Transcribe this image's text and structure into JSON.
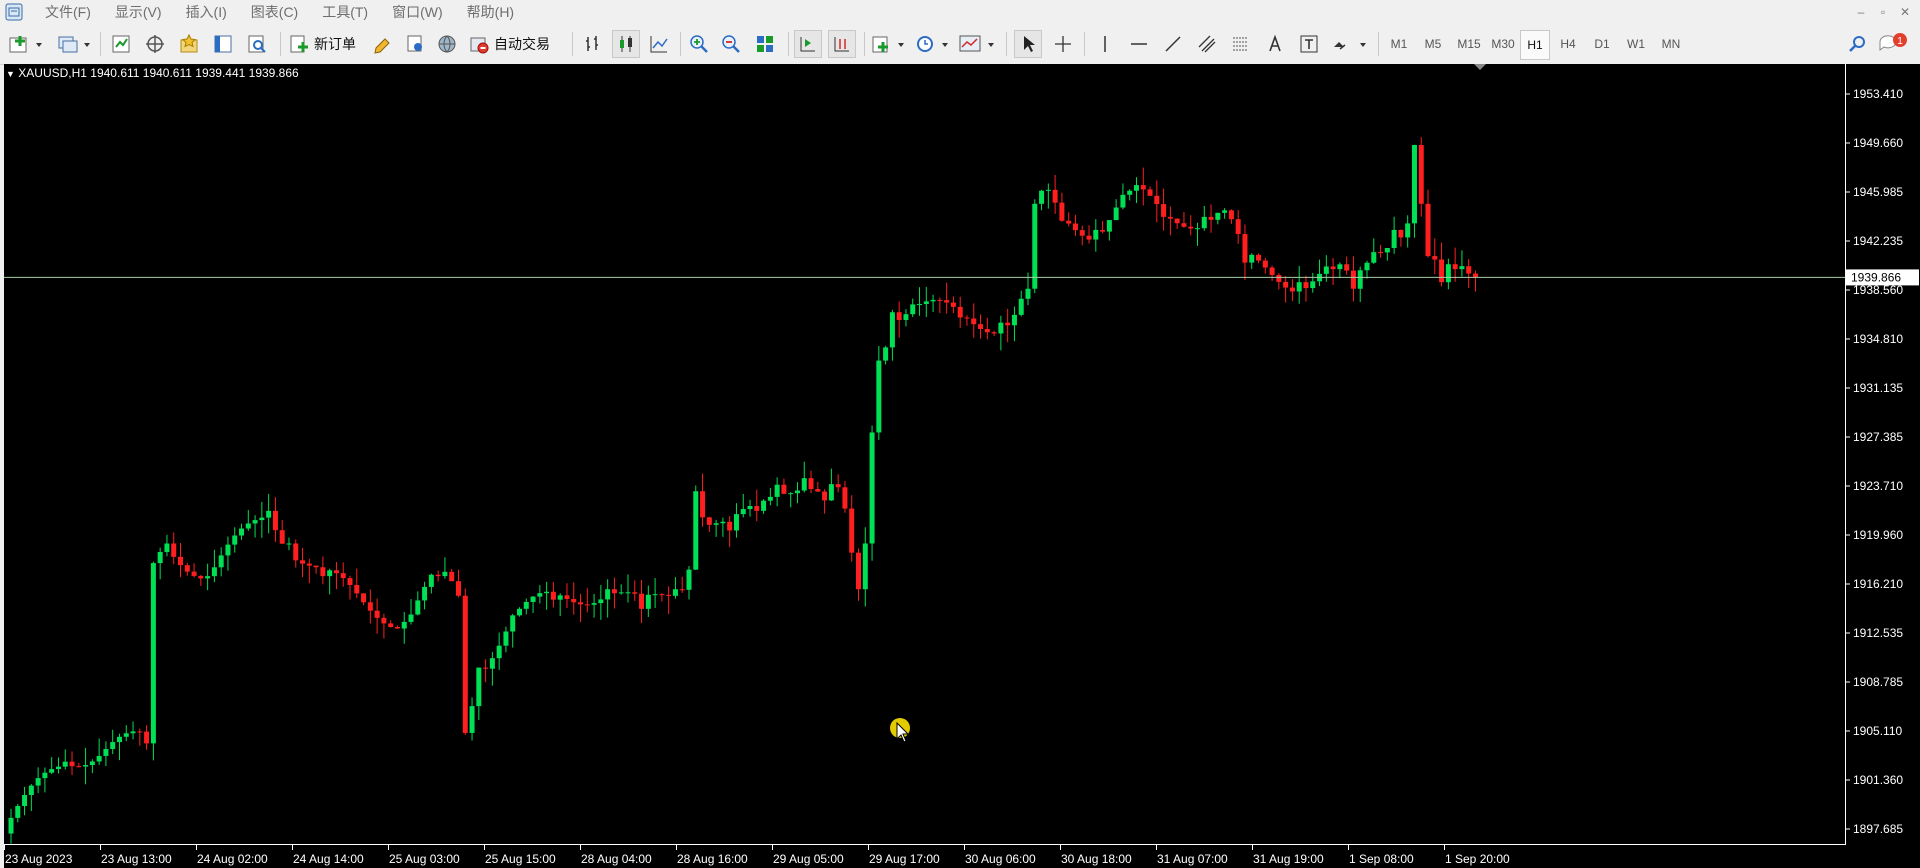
{
  "menu": {
    "items": [
      "文件(F)",
      "显示(V)",
      "插入(I)",
      "图表(C)",
      "工具(T)",
      "窗口(W)",
      "帮助(H)"
    ]
  },
  "toolbar": {
    "new_order_label": "新订单",
    "auto_trading_label": "自动交易",
    "timeframes": [
      "M1",
      "M5",
      "M15",
      "M30",
      "H1",
      "H4",
      "D1",
      "W1",
      "MN"
    ],
    "active_timeframe": "H1",
    "notification_count": "1"
  },
  "chart": {
    "symbol_info": "XAUUSD,H1  1940.611 1940.611 1939.441 1939.866",
    "current_price_label": "1939.866",
    "colors": {
      "background": "#000000",
      "bull_candle": "#00e055",
      "bear_candle": "#ff1f1f",
      "axis_text": "#ffffff",
      "price_line": "#a9cfa9"
    }
  },
  "chart_data": {
    "type": "candlestick",
    "symbol": "XAUUSD",
    "timeframe": "H1",
    "ylim": [
      1896.5,
      1956.2
    ],
    "y_ticks": [
      "1953.410",
      "1949.660",
      "1945.985",
      "1942.235",
      "1938.560",
      "1934.810",
      "1931.135",
      "1927.385",
      "1923.710",
      "1919.960",
      "1916.210",
      "1912.535",
      "1908.785",
      "1905.110",
      "1901.360",
      "1897.685"
    ],
    "x_ticks": [
      "23 Aug 2023",
      "23 Aug 13:00",
      "24 Aug 02:00",
      "24 Aug 14:00",
      "25 Aug 03:00",
      "25 Aug 15:00",
      "28 Aug 04:00",
      "28 Aug 16:00",
      "29 Aug 05:00",
      "29 Aug 17:00",
      "30 Aug 06:00",
      "30 Aug 18:00",
      "31 Aug 07:00",
      "31 Aug 19:00",
      "1 Sep 08:00",
      "1 Sep 20:00"
    ],
    "last_price": 1939.866,
    "anchors": [
      [
        0,
        1898.5
      ],
      [
        8,
        1902.8
      ],
      [
        15,
        1904.3
      ],
      [
        20,
        1904.2
      ],
      [
        21,
        1918.0
      ],
      [
        23,
        1919.5
      ],
      [
        29,
        1917.0
      ],
      [
        38,
        1922.0
      ],
      [
        41,
        1919.5
      ],
      [
        46,
        1917.0
      ],
      [
        52,
        1915.0
      ],
      [
        58,
        1913.5
      ],
      [
        63,
        1917.0
      ],
      [
        66,
        1915.5
      ],
      [
        67,
        1905.0
      ],
      [
        69,
        1910.0
      ],
      [
        74,
        1914.0
      ],
      [
        80,
        1915.2
      ],
      [
        88,
        1916.0
      ],
      [
        93,
        1914.5
      ],
      [
        98,
        1916.0
      ],
      [
        100,
        1917.5
      ],
      [
        101,
        1923.5
      ],
      [
        102,
        1921.5
      ],
      [
        106,
        1920.5
      ],
      [
        110,
        1922.0
      ],
      [
        113,
        1924.0
      ],
      [
        117,
        1924.5
      ],
      [
        120,
        1922.8
      ],
      [
        122,
        1923.8
      ],
      [
        124,
        1918.8
      ],
      [
        125,
        1916.0
      ],
      [
        126,
        1919.5
      ],
      [
        127,
        1928.0
      ],
      [
        128,
        1933.5
      ],
      [
        130,
        1937.2
      ],
      [
        133,
        1937.8
      ],
      [
        140,
        1936.8
      ],
      [
        146,
        1936.4
      ],
      [
        148,
        1937.0
      ],
      [
        150,
        1939.0
      ],
      [
        151,
        1945.5
      ],
      [
        152,
        1946.5
      ],
      [
        155,
        1944.2
      ],
      [
        160,
        1943.5
      ],
      [
        165,
        1946.5
      ],
      [
        170,
        1944.5
      ],
      [
        176,
        1944.5
      ],
      [
        179,
        1945.0
      ],
      [
        182,
        1941.0
      ],
      [
        190,
        1939.5
      ],
      [
        195,
        1940.5
      ],
      [
        198,
        1939.0
      ],
      [
        201,
        1941.8
      ],
      [
        204,
        1943.5
      ],
      [
        206,
        1944.0
      ],
      [
        207,
        1950.0
      ],
      [
        208,
        1945.5
      ],
      [
        209,
        1941.5
      ],
      [
        211,
        1939.5
      ],
      [
        213,
        1940.5
      ],
      [
        216,
        1939.9
      ]
    ]
  }
}
